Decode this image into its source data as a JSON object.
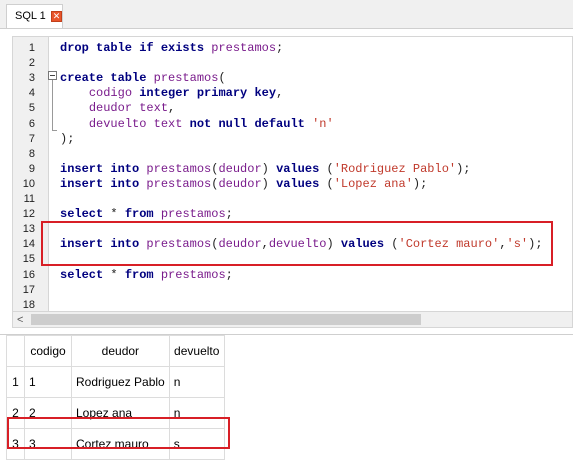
{
  "tab": {
    "label": "SQL 1",
    "close_symbol": "✕"
  },
  "editor": {
    "lines": [
      {
        "n": "1",
        "tokens": [
          [
            "kw",
            "drop table if exists "
          ],
          [
            "tb",
            "prestamos"
          ],
          [
            "pn",
            ";"
          ]
        ]
      },
      {
        "n": "2",
        "tokens": []
      },
      {
        "n": "3",
        "tokens": [
          [
            "kw",
            "create table "
          ],
          [
            "tb",
            "prestamos"
          ],
          [
            "pn",
            "("
          ]
        ]
      },
      {
        "n": "4",
        "tokens": [
          [
            "pn",
            "    "
          ],
          [
            "tb",
            "codigo "
          ],
          [
            "kw",
            "integer primary key"
          ],
          [
            "pn",
            ","
          ]
        ]
      },
      {
        "n": "5",
        "tokens": [
          [
            "pn",
            "    "
          ],
          [
            "tb",
            "deudor "
          ],
          [
            "tb",
            "text"
          ],
          [
            "pn",
            ","
          ]
        ]
      },
      {
        "n": "6",
        "tokens": [
          [
            "pn",
            "    "
          ],
          [
            "tb",
            "devuelto "
          ],
          [
            "tb",
            "text "
          ],
          [
            "kw",
            "not null default "
          ],
          [
            "str",
            "'n'"
          ]
        ]
      },
      {
        "n": "7",
        "tokens": [
          [
            "pn",
            ");"
          ]
        ]
      },
      {
        "n": "8",
        "tokens": []
      },
      {
        "n": "9",
        "tokens": [
          [
            "kw",
            "insert into "
          ],
          [
            "tb",
            "prestamos"
          ],
          [
            "pn",
            "("
          ],
          [
            "tb",
            "deudor"
          ],
          [
            "pn",
            ") "
          ],
          [
            "kw",
            "values "
          ],
          [
            "pn",
            "("
          ],
          [
            "str",
            "'Rodriguez Pablo'"
          ],
          [
            "pn",
            ");"
          ]
        ]
      },
      {
        "n": "10",
        "tokens": [
          [
            "kw",
            "insert into "
          ],
          [
            "tb",
            "prestamos"
          ],
          [
            "pn",
            "("
          ],
          [
            "tb",
            "deudor"
          ],
          [
            "pn",
            ") "
          ],
          [
            "kw",
            "values "
          ],
          [
            "pn",
            "("
          ],
          [
            "str",
            "'Lopez ana'"
          ],
          [
            "pn",
            ");"
          ]
        ]
      },
      {
        "n": "11",
        "tokens": []
      },
      {
        "n": "12",
        "tokens": [
          [
            "kw",
            "select "
          ],
          [
            "pn",
            "* "
          ],
          [
            "kw",
            "from "
          ],
          [
            "tb",
            "prestamos"
          ],
          [
            "pn",
            ";"
          ]
        ]
      },
      {
        "n": "13",
        "tokens": []
      },
      {
        "n": "14",
        "tokens": [
          [
            "kw",
            "insert into "
          ],
          [
            "tb",
            "prestamos"
          ],
          [
            "pn",
            "("
          ],
          [
            "tb",
            "deudor"
          ],
          [
            "pn",
            ","
          ],
          [
            "tb",
            "devuelto"
          ],
          [
            "pn",
            ") "
          ],
          [
            "kw",
            "values "
          ],
          [
            "pn",
            "("
          ],
          [
            "str",
            "'Cortez mauro'"
          ],
          [
            "pn",
            ","
          ],
          [
            "str",
            "'s'"
          ],
          [
            "pn",
            ");"
          ]
        ]
      },
      {
        "n": "15",
        "tokens": []
      },
      {
        "n": "16",
        "tokens": [
          [
            "kw",
            "select "
          ],
          [
            "pn",
            "* "
          ],
          [
            "kw",
            "from "
          ],
          [
            "tb",
            "prestamos"
          ],
          [
            "pn",
            ";"
          ]
        ]
      },
      {
        "n": "17",
        "tokens": []
      },
      {
        "n": "18",
        "tokens": []
      }
    ]
  },
  "scrollbar": {
    "left_arrow": "<"
  },
  "results": {
    "columns": [
      "codigo",
      "deudor",
      "devuelto"
    ],
    "rows": [
      {
        "rownum": "1",
        "cells": [
          "1",
          "Rodriguez Pablo",
          "n"
        ]
      },
      {
        "rownum": "2",
        "cells": [
          "2",
          "Lopez ana",
          "n"
        ]
      },
      {
        "rownum": "3",
        "cells": [
          "3",
          "Cortez mauro",
          "s"
        ]
      }
    ]
  },
  "colors": {
    "highlight": "#d81f26",
    "keyword": "#00007f",
    "identifier": "#7a1c8c",
    "string": "#c0392b"
  }
}
